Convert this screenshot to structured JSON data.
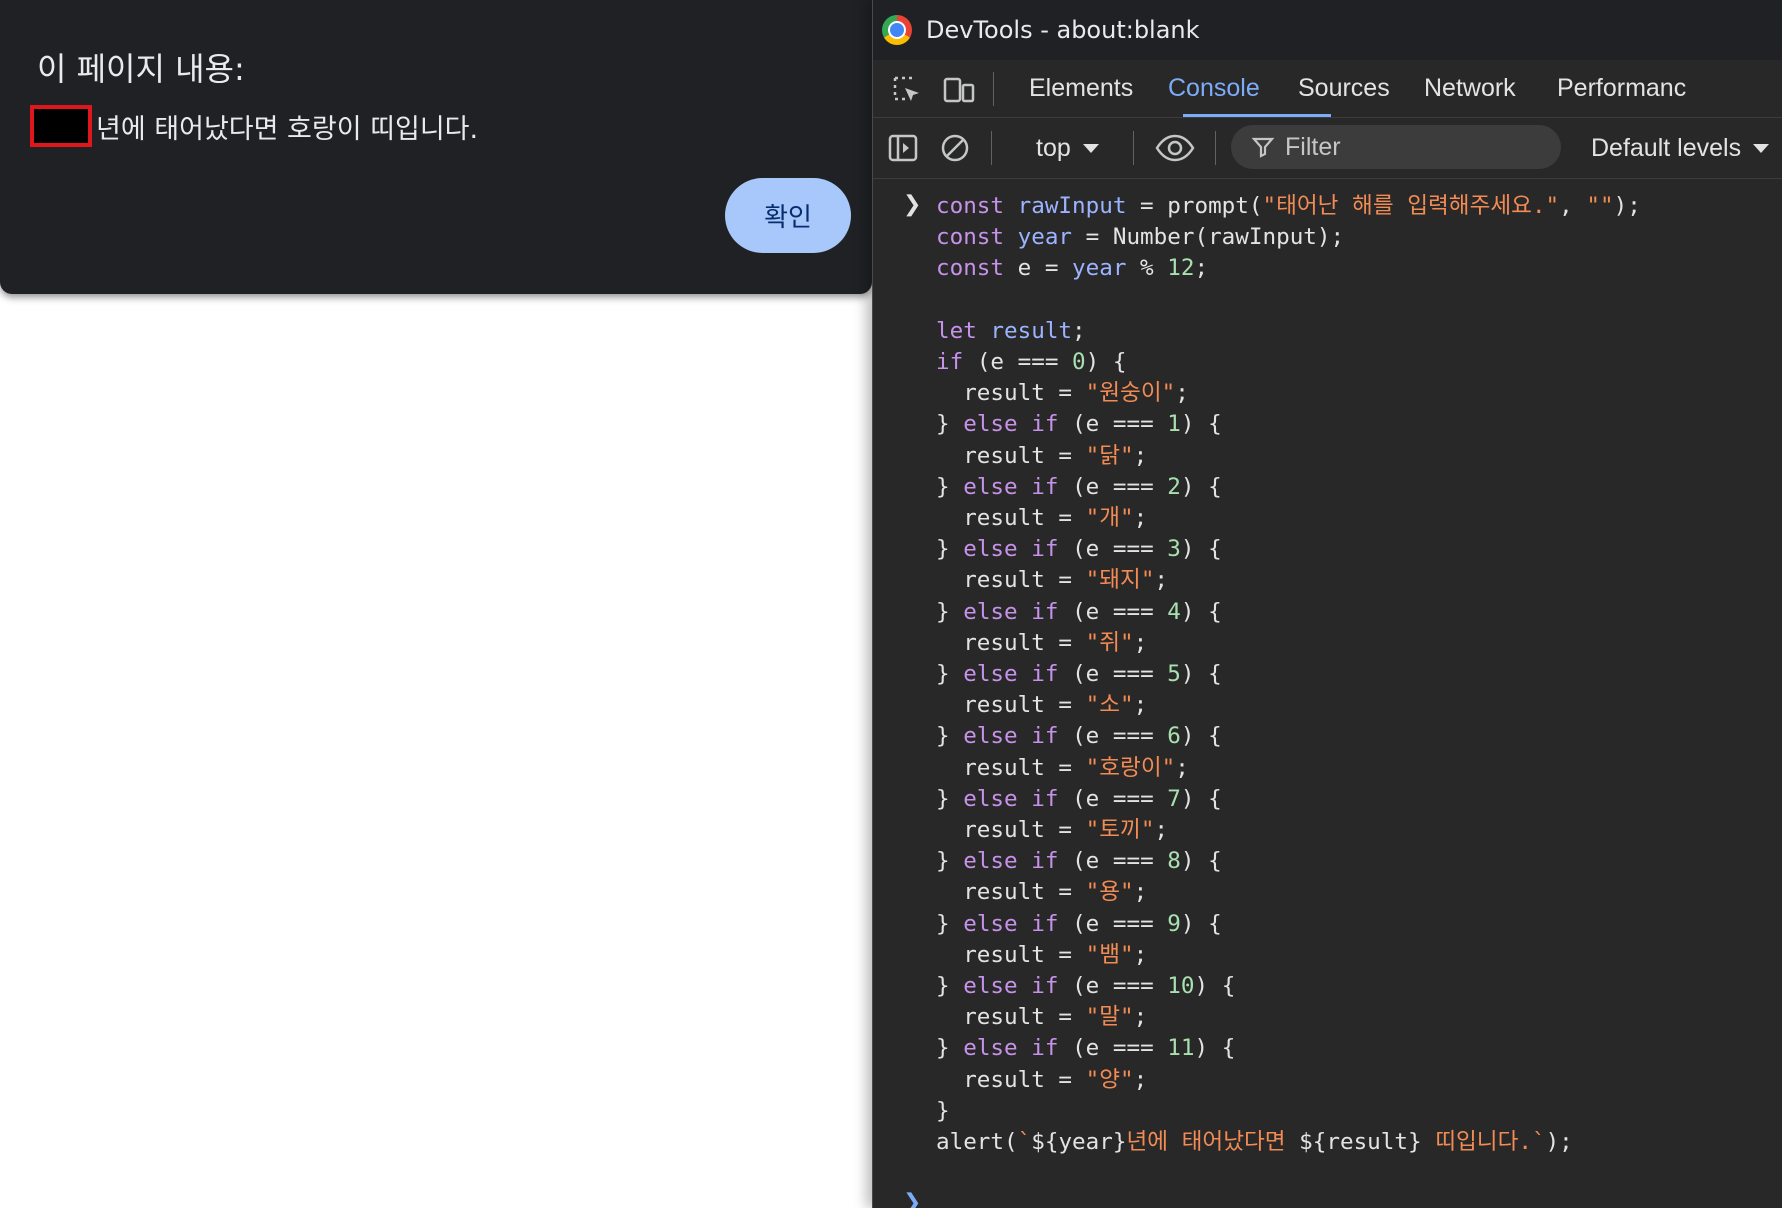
{
  "alert": {
    "title": "이 페이지 내용:",
    "message": "년에 태어났다면 호랑이 띠입니다.",
    "ok_label": "확인"
  },
  "devtools": {
    "window_title": "DevTools - about:blank",
    "tabs": [
      "Elements",
      "Console",
      "Sources",
      "Network",
      "Performanc"
    ],
    "active_tab": "Console",
    "context": "top",
    "filter_placeholder": "Filter",
    "levels": "Default levels",
    "accent_color": "#7cacf8"
  },
  "console": {
    "code_lines": [
      "const rawInput = prompt(\"태어난 해를 입력해주세요.\", \"\");",
      "const year = Number(rawInput);",
      "const e = year % 12;",
      "",
      "let result;",
      "if (e === 0) {",
      "  result = \"원숭이\";",
      "} else if (e === 1) {",
      "  result = \"닭\";",
      "} else if (e === 2) {",
      "  result = \"개\";",
      "} else if (e === 3) {",
      "  result = \"돼지\";",
      "} else if (e === 4) {",
      "  result = \"쥐\";",
      "} else if (e === 5) {",
      "  result = \"소\";",
      "} else if (e === 6) {",
      "  result = \"호랑이\";",
      "} else if (e === 7) {",
      "  result = \"토끼\";",
      "} else if (e === 8) {",
      "  result = \"용\";",
      "} else if (e === 9) {",
      "  result = \"뱀\";",
      "} else if (e === 10) {",
      "  result = \"말\";",
      "} else if (e === 11) {",
      "  result = \"양\";",
      "}",
      "alert(`${year}년에 태어났다면 ${result} 띠입니다.`);"
    ]
  }
}
